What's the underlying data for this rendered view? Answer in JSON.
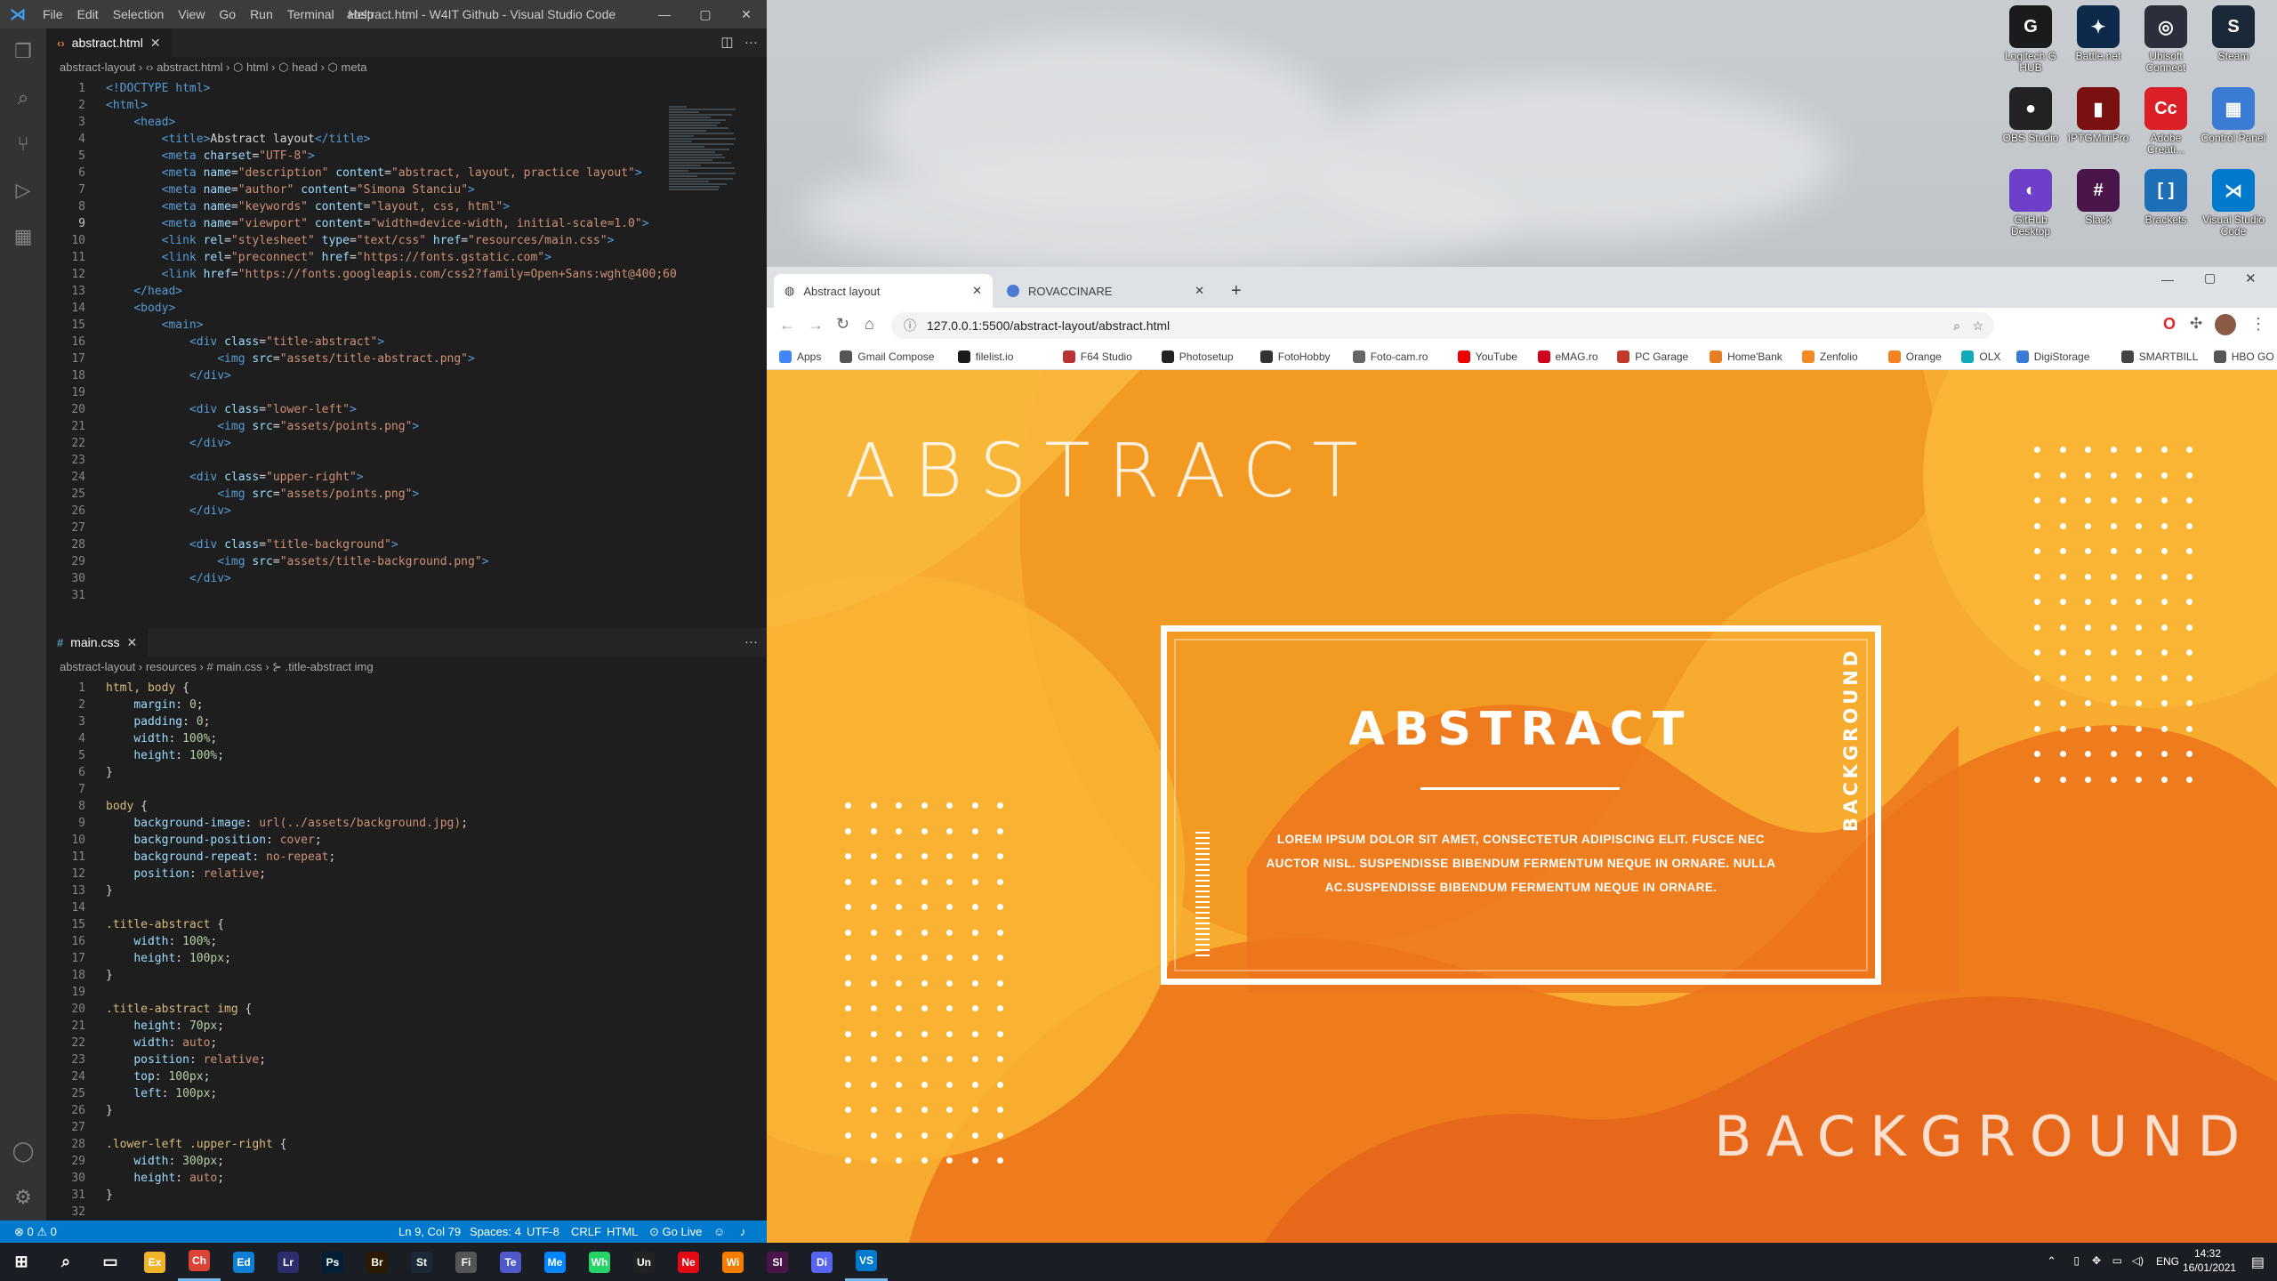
{
  "vscode": {
    "menu": [
      "File",
      "Edit",
      "Selection",
      "View",
      "Go",
      "Run",
      "Terminal",
      "Help"
    ],
    "window_title": "abstract.html - W4IT Github - Visual Studio Code",
    "top_tab": "abstract.html",
    "top_breadcrumb": "abstract-layout  ›  ‹›  abstract.html  ›  ⬡ html  ›  ⬡ head  ›  ⬡ meta",
    "bottom_tab": "main.css",
    "bottom_breadcrumb": "abstract-layout  ›  resources  ›  #  main.css  ›  ⊱  .title-abstract img",
    "status": {
      "problems": "⊗ 0 ⚠ 0",
      "position": "Ln 9, Col 79",
      "spaces": "Spaces: 4",
      "encoding": "UTF-8",
      "eol": "CRLF",
      "language": "HTML",
      "golive": "⊙ Go Live"
    }
  },
  "desktop_icons": [
    {
      "label": "Logitech G HUB",
      "icon": "G",
      "color": "#1b1b1b"
    },
    {
      "label": "Battle.net",
      "icon": "✦",
      "color": "#0e2a4a"
    },
    {
      "label": "Ubisoft Connect",
      "icon": "◎",
      "color": "#2a2f3a"
    },
    {
      "label": "Steam",
      "icon": "S",
      "color": "#1b2838"
    },
    {
      "label": "OBS Studio",
      "icon": "●",
      "color": "#222"
    },
    {
      "label": "IPTGMiniPro",
      "icon": "▮",
      "color": "#7a1010"
    },
    {
      "label": "Adobe Creati...",
      "icon": "Cc",
      "color": "#da1f26"
    },
    {
      "label": "Control Panel",
      "icon": "▦",
      "color": "#3a7bd5"
    },
    {
      "label": "GitHub Desktop",
      "icon": "◐",
      "color": "#6e40c9"
    },
    {
      "label": "Slack",
      "icon": "#",
      "color": "#4a154b"
    },
    {
      "label": "Brackets",
      "icon": "[ ]",
      "color": "#1d6fb8"
    },
    {
      "label": "Visual Studio Code",
      "icon": "⋊",
      "color": "#007acc"
    }
  ],
  "chrome": {
    "tab1": "Abstract layout",
    "tab2": "ROVACCINARE",
    "url": "127.0.0.1:5500/abstract-layout/abstract.html",
    "bookmarks": [
      "Apps",
      "Gmail Compose",
      "filelist.io",
      "F64 Studio",
      "Photosetup",
      "FotoHobby",
      "Foto-cam.ro",
      "YouTube",
      "eMAG.ro",
      "PC Garage",
      "Home'Bank",
      "Zenfolio",
      "Orange",
      "OLX",
      "DigiStorage",
      "SMARTBILL",
      "HBO GO"
    ],
    "page": {
      "big_title": "ABSTRACT",
      "frame_title": "ABSTRACT",
      "frame_text": "LOREM IPSUM DOLOR SIT AMET, CONSECTETUR ADIPISCING ELIT. FUSCE NEC AUCTOR NISL. SUSPENDISSE BIBENDUM FERMENTUM NEQUE IN ORNARE. NULLA AC.SUSPENDISSE BIBENDUM FERMENTUM NEQUE IN ORNARE.",
      "frame_vertical": "BACKGROUND",
      "big_background": "BACKGROUND",
      "colors": {
        "orange_light": "#f9b233",
        "orange_mid": "#f39121",
        "orange_dark": "#e86a19"
      }
    }
  },
  "taskbar": {
    "apps": [
      "⊞",
      "⌕",
      "▭",
      "Explorer",
      "Chrome",
      "Edge",
      "Lrc",
      "Ps",
      "Br",
      "Steam",
      "Files",
      "Teams",
      "Messenger",
      "WhatsApp",
      "Unity",
      "Netflix",
      "Winamp",
      "Slack",
      "Discord",
      "VS Code"
    ],
    "lang": "ENG",
    "time": "14:32",
    "date": "16/01/2021"
  }
}
